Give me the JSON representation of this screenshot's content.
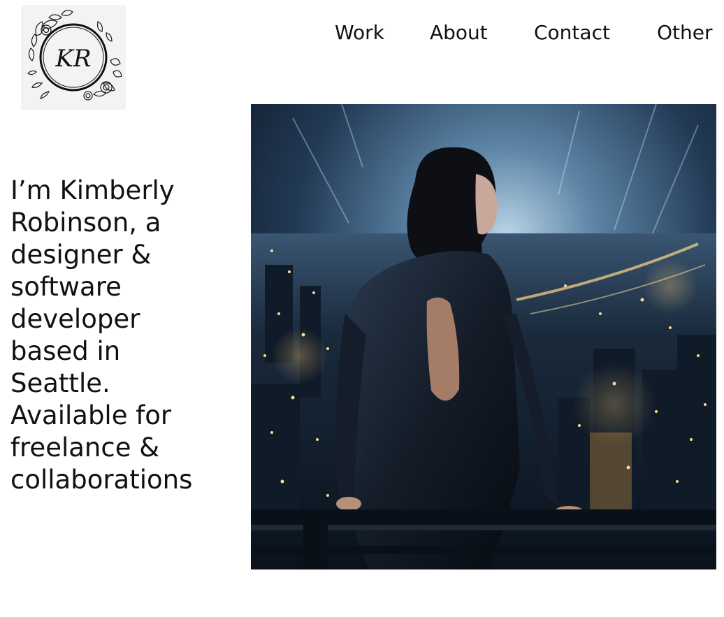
{
  "logo": {
    "monogram": "KR",
    "icon": "floral-monogram-logo"
  },
  "nav": {
    "items": [
      {
        "label": "Work"
      },
      {
        "label": "About"
      },
      {
        "label": "Contact"
      },
      {
        "label": "Other"
      }
    ]
  },
  "intro": {
    "lines": [
      "I’m Kimberly",
      "Robinson, a",
      "designer &",
      "software",
      "developer",
      "based in",
      "Seattle.",
      "Available for",
      "freelance &",
      "collaborations"
    ]
  },
  "hero": {
    "icon": "woman-overlooking-night-city-image"
  }
}
